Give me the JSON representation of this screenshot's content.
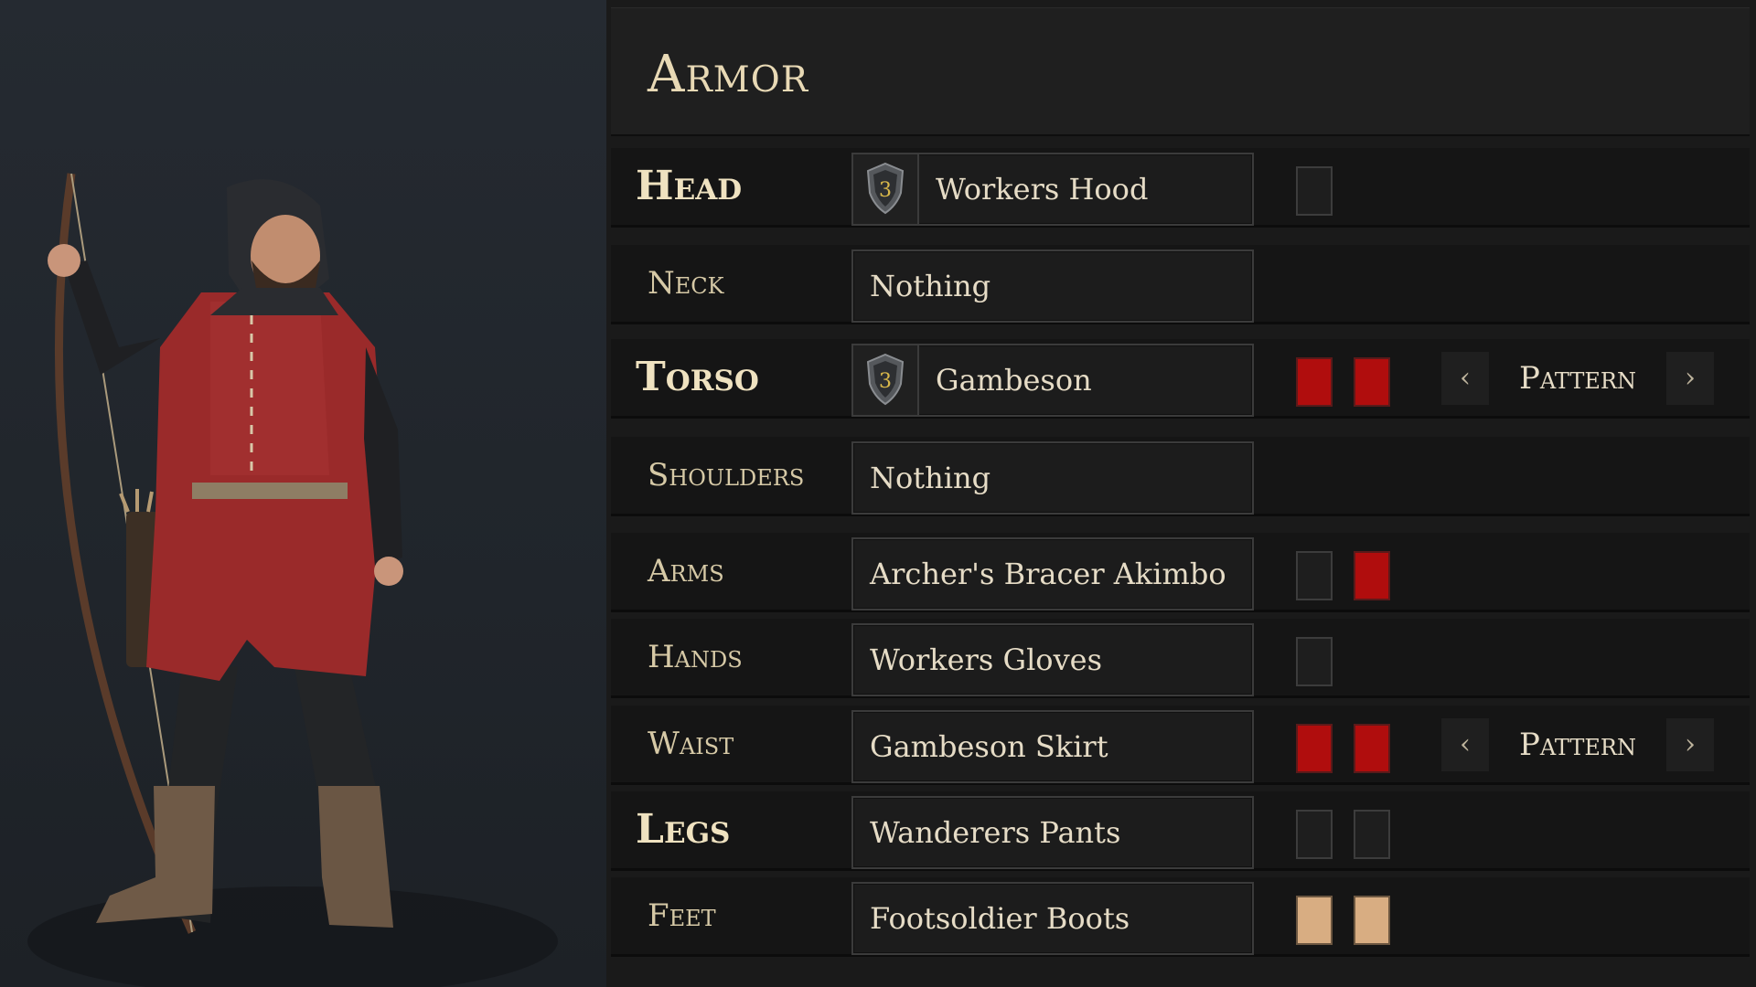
{
  "panel": {
    "title": "Armor"
  },
  "slots": [
    {
      "id": "head",
      "label": "Head",
      "item": "Workers Hood",
      "tier": "3"
    },
    {
      "id": "neck",
      "label": "Neck",
      "item": "Nothing"
    },
    {
      "id": "torso",
      "label": "Torso",
      "item": "Gambeson",
      "tier": "3",
      "pattern": "Pattern"
    },
    {
      "id": "shoulders",
      "label": "Shoulders",
      "item": "Nothing"
    },
    {
      "id": "arms",
      "label": "Arms",
      "item": "Archer's Bracer Akimbo"
    },
    {
      "id": "hands",
      "label": "Hands",
      "item": "Workers Gloves"
    },
    {
      "id": "waist",
      "label": "Waist",
      "item": "Gambeson Skirt",
      "pattern": "Pattern"
    },
    {
      "id": "legs",
      "label": "Legs",
      "item": "Wanderers Pants"
    },
    {
      "id": "feet",
      "label": "Feet",
      "item": "Footsoldier Boots"
    }
  ],
  "colors": {
    "red": "#b00d0d",
    "dark": "#1e1e1e",
    "tan": "#d8ad82",
    "title_text": "#e8d9b5"
  },
  "icons": {
    "tier_badge": "shield-icon",
    "pattern_prev": "chevron-left-icon",
    "pattern_next": "chevron-right-icon"
  }
}
